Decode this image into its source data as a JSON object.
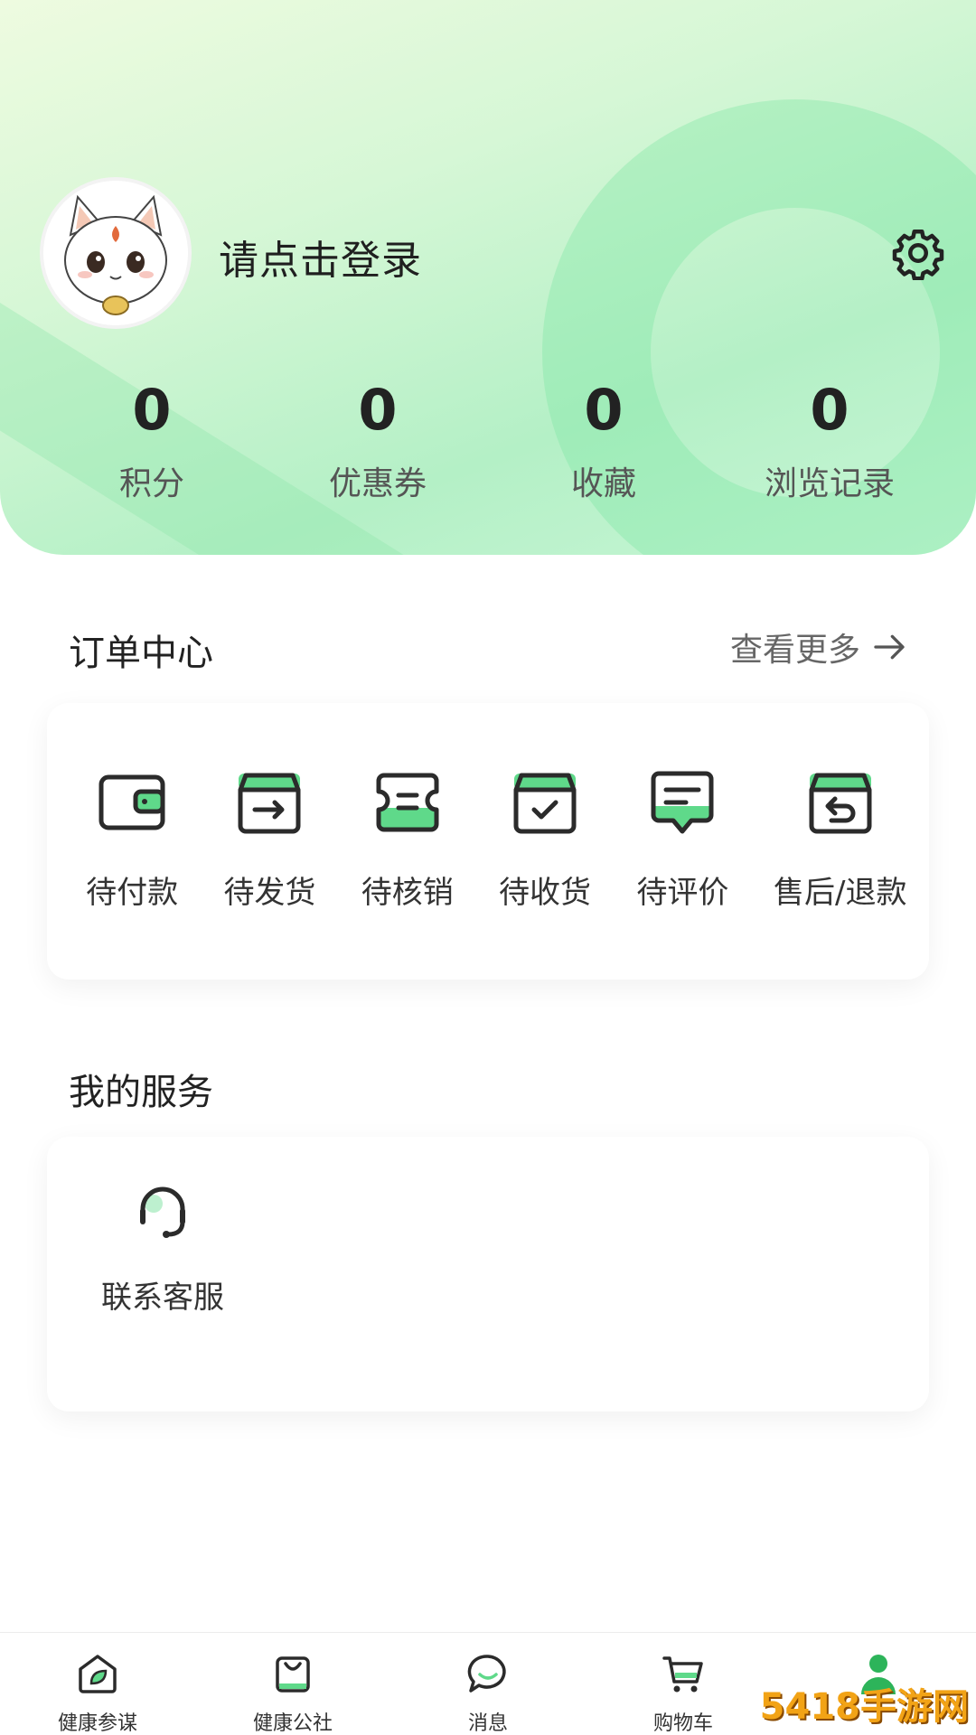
{
  "profile": {
    "login_prompt": "请点击登录",
    "avatar_icon": "cartoon-cat-avatar"
  },
  "stats": [
    {
      "value": "0",
      "label": "积分"
    },
    {
      "value": "0",
      "label": "优惠券"
    },
    {
      "value": "0",
      "label": "收藏"
    },
    {
      "value": "0",
      "label": "浏览记录"
    }
  ],
  "order_center": {
    "title": "订单中心",
    "more_label": "查看更多",
    "items": [
      {
        "label": "待付款",
        "icon": "wallet-icon"
      },
      {
        "label": "待发货",
        "icon": "box-arrow-icon"
      },
      {
        "label": "待核销",
        "icon": "ticket-icon"
      },
      {
        "label": "待收货",
        "icon": "box-check-icon"
      },
      {
        "label": "待评价",
        "icon": "comment-icon"
      },
      {
        "label": "售后/退款",
        "icon": "box-return-icon"
      }
    ]
  },
  "my_services": {
    "title": "我的服务",
    "items": [
      {
        "label": "联系客服",
        "icon": "headset-icon"
      }
    ]
  },
  "tabbar": {
    "items": [
      {
        "label": "健康参谋",
        "icon": "home-leaf-icon"
      },
      {
        "label": "健康公社",
        "icon": "shopping-bag-icon"
      },
      {
        "label": "消息",
        "icon": "chat-bubble-icon"
      },
      {
        "label": "购物车",
        "icon": "cart-icon"
      },
      {
        "label": "",
        "icon": "user-icon",
        "active": true
      }
    ]
  },
  "watermark": "5418手游网",
  "colors": {
    "accent": "#5fd98a",
    "active_tab": "#2db45a",
    "text_primary": "#222222",
    "text_secondary": "#666666"
  }
}
